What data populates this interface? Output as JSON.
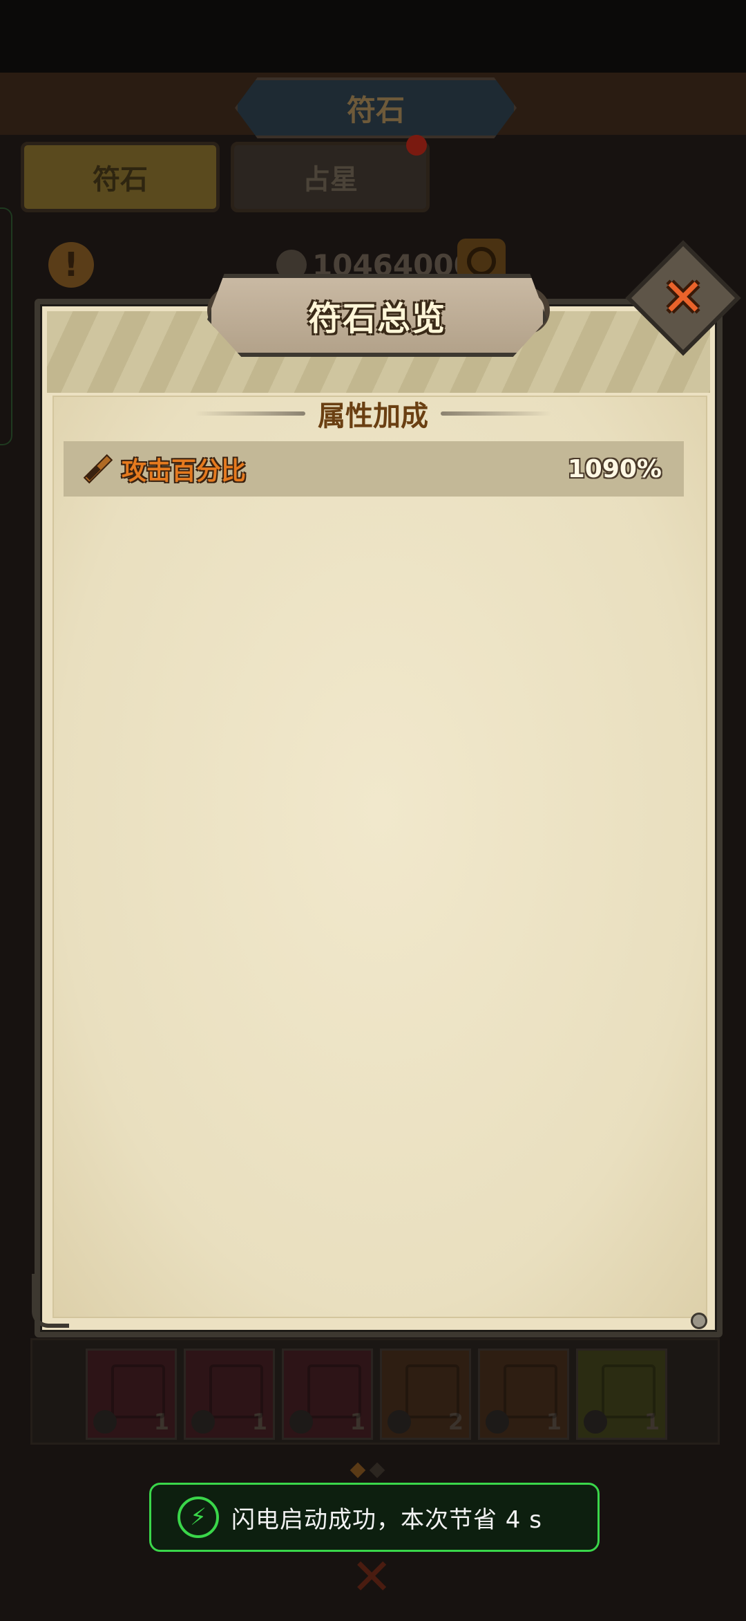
{
  "background": {
    "title": "符石",
    "tabs": [
      {
        "label": "符石",
        "active": true
      },
      {
        "label": "占星",
        "active": false,
        "has_notification": true
      }
    ],
    "currency_value": "10464000",
    "inventory": [
      {
        "count": "1",
        "color": "#2d1417",
        "icon": "shield-icon"
      },
      {
        "count": "1",
        "color": "#2d1417",
        "icon": "heart-icon"
      },
      {
        "count": "1",
        "color": "#2d1417",
        "icon": "heart-icon"
      },
      {
        "count": "2",
        "color": "#2e1e12",
        "icon": "sword-icon"
      },
      {
        "count": "1",
        "color": "#2e1e12",
        "icon": "sword-icon"
      },
      {
        "count": "1",
        "color": "#2b2c12",
        "icon": "shield-icon"
      }
    ]
  },
  "modal": {
    "title": "符石总览",
    "section_title": "属性加成",
    "attributes": [
      {
        "icon": "sword-icon",
        "name": "攻击百分比",
        "value": "1090%"
      }
    ]
  },
  "toast": {
    "icon": "lightning-icon",
    "text": "闪电启动成功，本次节省 4 s"
  },
  "colors": {
    "accent_orange": "#e57a1f",
    "toast_green": "#3ad64a",
    "parchment": "#ece1c2"
  }
}
